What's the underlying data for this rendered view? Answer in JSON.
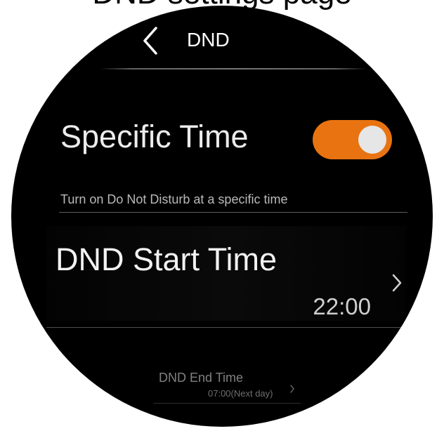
{
  "top_text": "DND settings page",
  "header": {
    "back_icon": "chevron-left-icon",
    "title": "DND"
  },
  "specific_time": {
    "label": "Specific Time",
    "enabled": true,
    "description": "Turn on Do Not Disturb at a specific time",
    "toggle_color": "#e97310",
    "knob_color": "#e6e6e6"
  },
  "start_time": {
    "label": "DND Start Time",
    "value": "22:00",
    "chevron_icon": "chevron-right-icon"
  },
  "end_time": {
    "label": "DND End Time",
    "value": "07:00(Next day)",
    "chevron_icon": "chevron-right-icon"
  },
  "colors": {
    "background": "#000000",
    "accent": "#e97310",
    "primary_text": "#ffffff",
    "secondary_text": "#b9b9b9"
  }
}
